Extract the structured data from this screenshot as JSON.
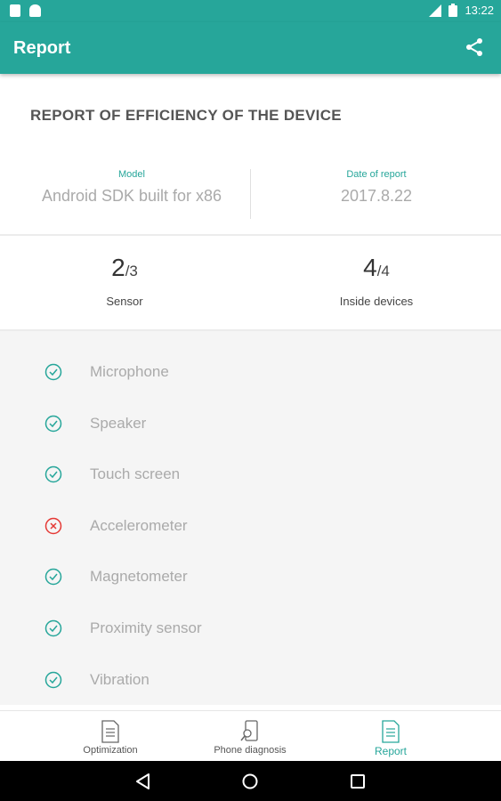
{
  "status_bar": {
    "time": "13:22",
    "network": "LTE"
  },
  "app_bar": {
    "title": "Report",
    "share_icon": "share-icon"
  },
  "report": {
    "heading": "REPORT OF EFFICIENCY OF THE DEVICE"
  },
  "info": {
    "model_label": "Model",
    "model_value": "Android SDK built for x86",
    "date_label": "Date of report",
    "date_value": "2017.8.22"
  },
  "stats": {
    "sensor": {
      "count": "2",
      "total": "/3",
      "label": "Sensor"
    },
    "inside": {
      "count": "4",
      "total": "/4",
      "label": "Inside devices"
    }
  },
  "checks": [
    {
      "label": "Microphone",
      "status": "ok"
    },
    {
      "label": "Speaker",
      "status": "ok"
    },
    {
      "label": "Touch screen",
      "status": "ok"
    },
    {
      "label": "Accelerometer",
      "status": "fail"
    },
    {
      "label": "Magnetometer",
      "status": "ok"
    },
    {
      "label": "Proximity sensor",
      "status": "ok"
    },
    {
      "label": "Vibration",
      "status": "ok"
    }
  ],
  "bottom_nav": [
    {
      "label": "Optimization",
      "icon": "document-icon",
      "active": false
    },
    {
      "label": "Phone diagnosis",
      "icon": "phone-search-icon",
      "active": false
    },
    {
      "label": "Report",
      "icon": "document-icon",
      "active": true
    }
  ],
  "colors": {
    "accent": "#26a69a",
    "ok": "#26a69a",
    "fail": "#e53935"
  }
}
